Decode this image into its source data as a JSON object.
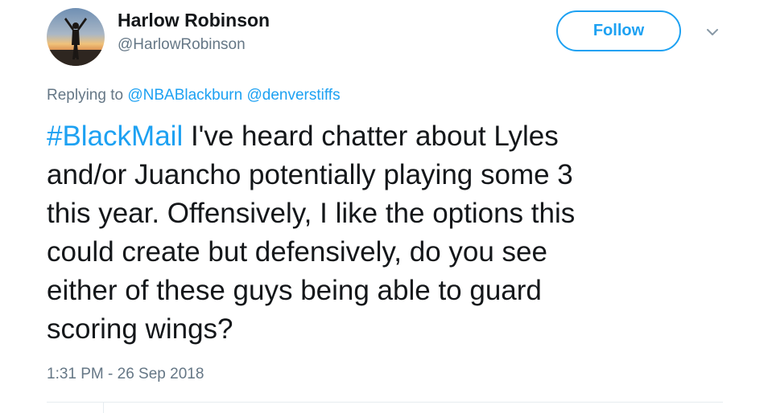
{
  "author": {
    "display_name": "Harlow Robinson",
    "handle": "@HarlowRobinson",
    "avatar_icon": "person-silhouette-sunset-avatar"
  },
  "follow": {
    "label": "Follow"
  },
  "menu": {
    "icon": "chevron-down-icon"
  },
  "reply": {
    "prefix": "Replying to",
    "mentions": [
      "@NBABlackburn",
      "@denverstiffs"
    ]
  },
  "tweet": {
    "hashtag": "#BlackMail",
    "text": " I've heard chatter about Lyles\nand/or Juancho potentially playing some 3\nthis year.  Offensively, I like the options this\ncould create but defensively, do you see\neither of these guys being able to guard\nscoring wings?"
  },
  "timestamp": "1:31 PM - 26 Sep 2018",
  "colors": {
    "accent": "#1da1f2",
    "secondary_text": "#657786",
    "primary_text": "#14171a",
    "divider": "#e6ecf0"
  }
}
